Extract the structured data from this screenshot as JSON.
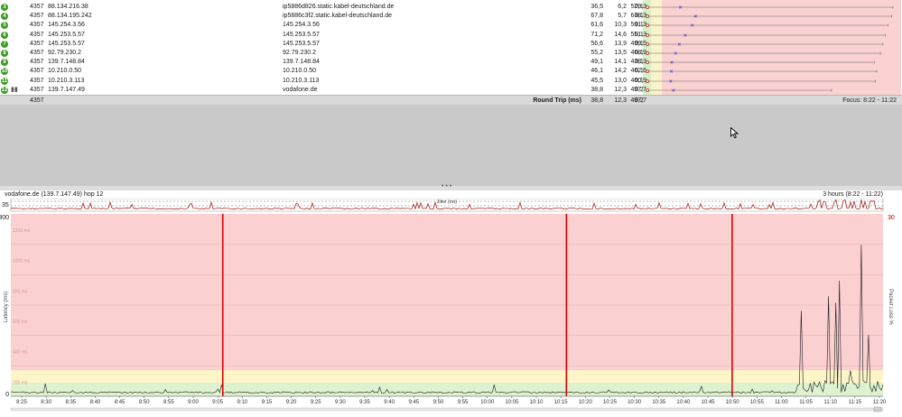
{
  "table": {
    "rows": [
      {
        "hop": "3",
        "count": "4357",
        "ip": "88.134.216.38",
        "name": "ip5886d826.static.kabel-deutschland.de",
        "avg": "36,5",
        "min": "6,2",
        "cur": "529,3",
        "pl": "0,1",
        "marker": 0.128,
        "whisker": 0.975
      },
      {
        "hop": "4",
        "count": "4357",
        "ip": "88.134.195.242",
        "name": "ip5886c3f2.static.kabel-deutschland.de",
        "avg": "67,8",
        "min": "5,7",
        "cur": "638,3",
        "pl": "0,1",
        "marker": 0.188,
        "whisker": 0.97
      },
      {
        "hop": "5",
        "count": "4357",
        "ip": "145.254.3.56",
        "name": "145.254.3.56",
        "avg": "61,6",
        "min": "10,3",
        "cur": "591,3",
        "pl": "0,1",
        "marker": 0.175,
        "whisker": 0.955
      },
      {
        "hop": "6",
        "count": "4357",
        "ip": "145.253.5.57",
        "name": "145.253.5.57",
        "avg": "71,2",
        "min": "14,6",
        "cur": "551,3",
        "pl": "0,1",
        "marker": 0.147,
        "whisker": 0.945
      },
      {
        "hop": "7",
        "count": "4357",
        "ip": "145.253.5.57",
        "name": "145.253.5.57",
        "avg": "56,6",
        "min": "13,9",
        "cur": "499,5",
        "pl": "0,1",
        "marker": 0.124,
        "whisker": 0.935
      },
      {
        "hop": "8",
        "count": "4357",
        "ip": "92.79.230.2",
        "name": "92.79.230.2",
        "avg": "55,2",
        "min": "13,5",
        "cur": "468,9",
        "pl": "0,1",
        "marker": 0.108,
        "whisker": 0.925
      },
      {
        "hop": "9",
        "count": "4357",
        "ip": "139.7.148.84",
        "name": "139.7.148.84",
        "avg": "49,1",
        "min": "14,1",
        "cur": "438,3",
        "pl": "0,1",
        "marker": 0.094,
        "whisker": 0.9
      },
      {
        "hop": "10",
        "count": "4357",
        "ip": "10.210.0.50",
        "name": "10.210.0.50",
        "avg": "46,1",
        "min": "14,2",
        "cur": "462,6",
        "pl": "0,1",
        "marker": 0.092,
        "whisker": 0.91
      },
      {
        "hop": "11",
        "count": "4357",
        "ip": "10.210.3.113",
        "name": "10.210.3.113",
        "avg": "45,5",
        "min": "13,0",
        "cur": "460,9",
        "pl": "0,1",
        "marker": 0.089,
        "whisker": 0.905
      },
      {
        "hop": "12",
        "count": "4357",
        "ip": "139.7.147.49",
        "name": "vodafone.de",
        "avg": "38,8",
        "min": "12,3",
        "cur": "497,7",
        "pl": "0,2",
        "marker": 0.1,
        "whisker": 0.73
      }
    ],
    "summary": {
      "count": "4357",
      "label": "Round Trip (ms)",
      "avg": "38,8",
      "min": "12,3",
      "cur": "497,7",
      "pl": "0,2",
      "focus": "Focus: 8:22 - 11:22"
    },
    "colors": {
      "zone_green": "#d8f0c8",
      "zone_yellow": "#fbf3c9",
      "zone_red": "#fad2d2",
      "marker": "#1f1fd8",
      "whisker": "#666666",
      "hop_badge": "#3c9a22"
    }
  },
  "splitter": {
    "dots": "• • •"
  },
  "chart": {
    "header_left": "vodafone.de (139.7.147.49) hop 12",
    "header_right": "3 hours (8:22 - 11:22)",
    "jitter_label": "Jitter (ms)",
    "jitter_axis": "35",
    "ylabel_left": "Latency (ms)",
    "ylabel_right": "Packet Loss %",
    "ymax_left": "300",
    "ymin_left": "0",
    "ymax_right": "30",
    "ylabels_inner": [
      "1200 ms",
      "1000 ms",
      "800 ms",
      "600 ms",
      "400 ms",
      "200 ms"
    ],
    "xticks": [
      "8:25",
      "8:30",
      "8:35",
      "8:40",
      "8:45",
      "8:50",
      "8:55",
      "9:00",
      "9:05",
      "9:10",
      "9:15",
      "9:20",
      "9:25",
      "9:30",
      "9:35",
      "9:40",
      "9:45",
      "9:50",
      "9:55",
      "10:00",
      "10:05",
      "10:10",
      "10:15",
      "10:20",
      "10:25",
      "10:30",
      "10:35",
      "10:40",
      "10:45",
      "10:50",
      "10:55",
      "11:00",
      "11:05",
      "11:10",
      "11:15",
      "11:20"
    ],
    "loss_markers_fraction": [
      0.243,
      0.637,
      0.827
    ],
    "colors": {
      "bg_red": "#fbd0d0",
      "bg_yellow": "#fbf5c8",
      "bg_green": "#dff2cf",
      "line": "#1a1a1a",
      "loss": "#e00000",
      "jitter": "#a01010"
    }
  }
}
